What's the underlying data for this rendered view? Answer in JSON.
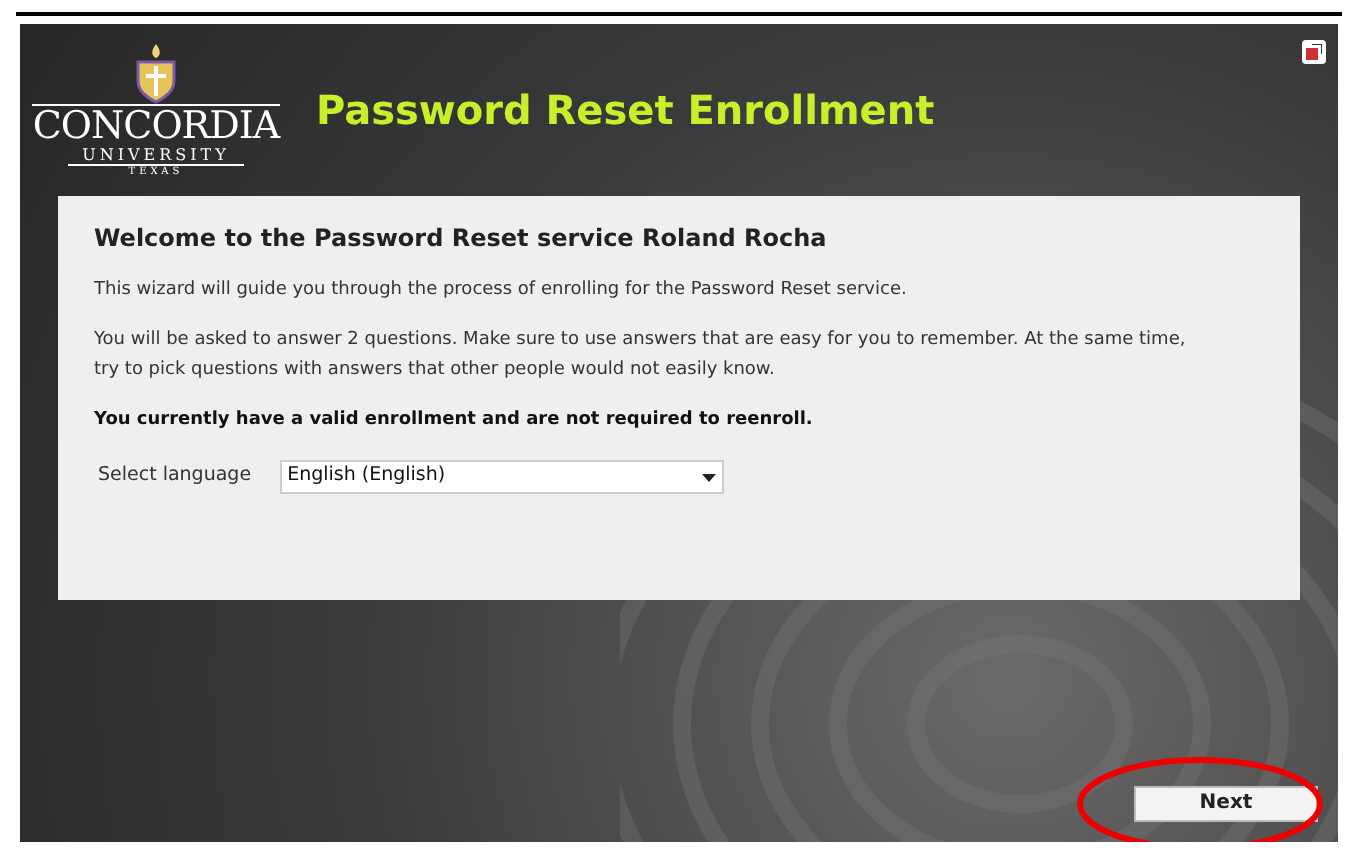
{
  "header": {
    "logo": {
      "name": "CONCORDIA",
      "line_2": "UNIVERSITY",
      "line_3": "TEXAS"
    },
    "title": "Password Reset Enrollment"
  },
  "panel": {
    "heading": "Welcome to the Password Reset service Roland Rocha",
    "paragraphs": [
      {
        "kind": "plain",
        "text": "This wizard will guide you through the process of enrolling for the Password Reset service."
      },
      {
        "kind": "plain",
        "text": "You will be asked to answer 2 questions. Make sure to use answers that are easy for you to remember. At the same time, try to pick questions with answers that other people would not easily know."
      },
      {
        "kind": "bold",
        "text": "You currently have a valid enrollment and are not required to reenroll."
      }
    ],
    "language": {
      "label": "Select language",
      "value": "English (English)"
    }
  },
  "footer": {
    "next_button": "Next",
    "highlighted": true
  }
}
